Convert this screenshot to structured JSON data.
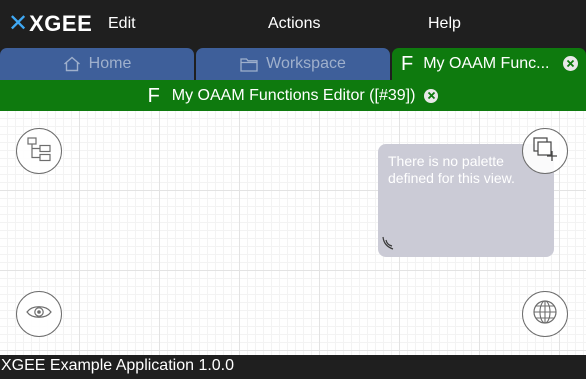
{
  "app": {
    "logo_x": "✕",
    "logo_name": "XGEE"
  },
  "menu": {
    "edit": "Edit",
    "actions": "Actions",
    "help": "Help"
  },
  "tabs": [
    {
      "label": "Home",
      "icon": "home-icon"
    },
    {
      "label": "Workspace",
      "icon": "folder-icon"
    },
    {
      "label": "My OAAM Func...",
      "prefix": "F",
      "icon": "close-icon"
    }
  ],
  "editor": {
    "prefix": "F",
    "title": "My OAAM Functions Editor ([#39])"
  },
  "palette": {
    "message": "There is no palette defined for this view."
  },
  "canvas_buttons": {
    "top_left": "hierarchy-icon",
    "bottom_left": "eye-icon",
    "top_right": "add-copy-icon",
    "bottom_right": "globe-icon"
  },
  "colors": {
    "bar_dark": "#1f1f1f",
    "tab_inactive": "#3e5f9a",
    "editor_green": "#0e7a0e",
    "logo_accent": "#3fa9f5",
    "palette_bg": "#cbcbd6"
  },
  "status": {
    "text": "XGEE Example Application 1.0.0"
  }
}
